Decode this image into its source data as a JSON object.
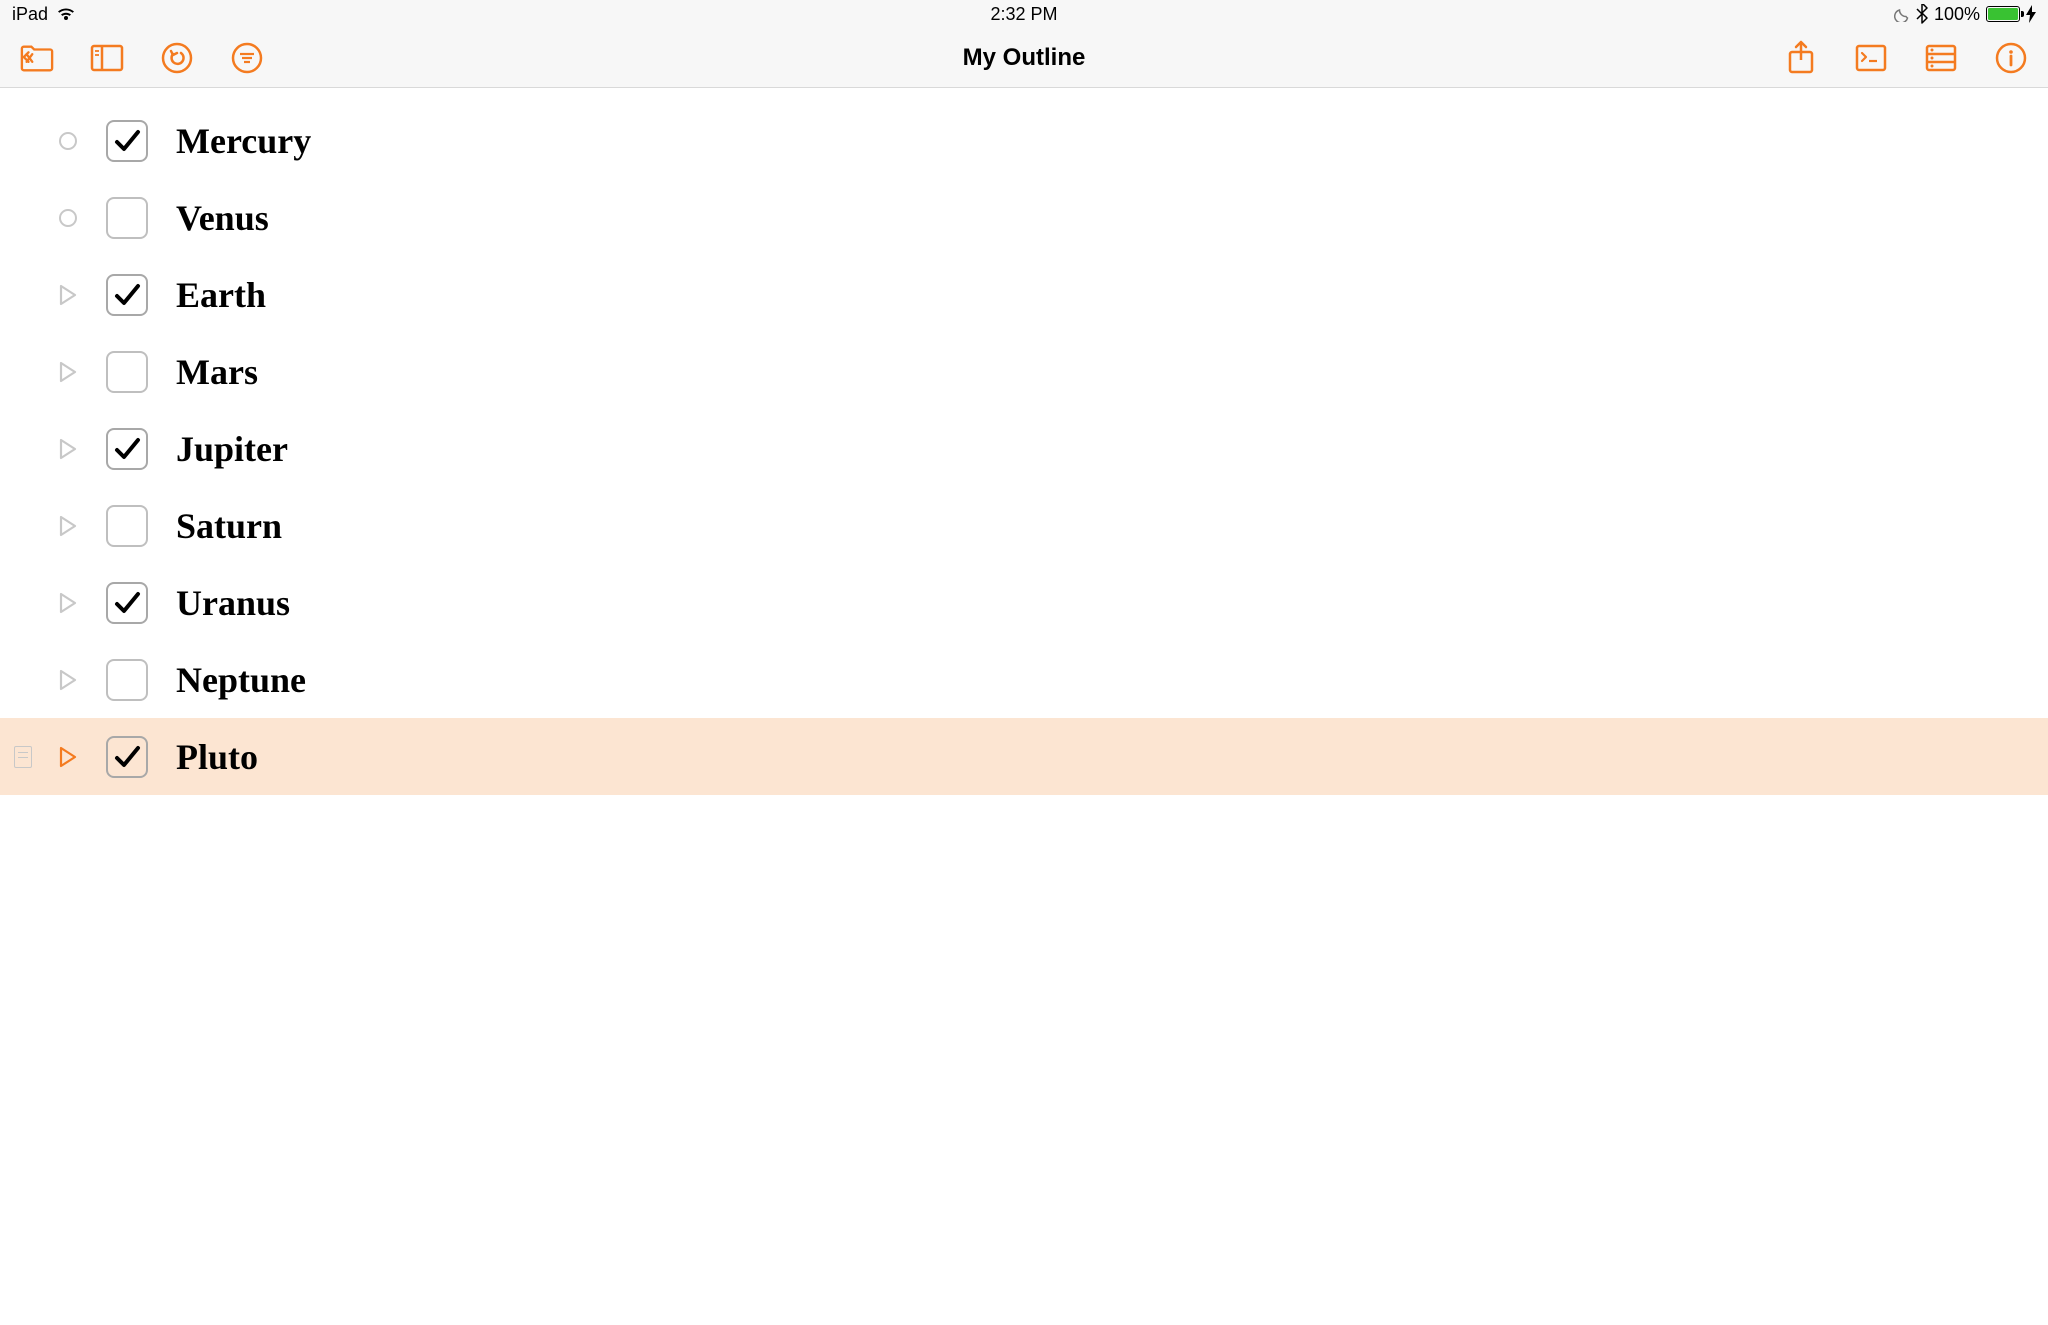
{
  "status_bar": {
    "device": "iPad",
    "time": "2:32 PM",
    "battery_pct": "100%"
  },
  "toolbar": {
    "title": "My Outline"
  },
  "colors": {
    "accent": "#f47b20",
    "selection_bg": "#fce5d2",
    "battery_fill": "#39c232"
  },
  "outline": {
    "items": [
      {
        "label": "Mercury",
        "checked": true,
        "handle": "circle",
        "selected": false,
        "has_note": false
      },
      {
        "label": "Venus",
        "checked": false,
        "handle": "circle",
        "selected": false,
        "has_note": false
      },
      {
        "label": "Earth",
        "checked": true,
        "handle": "triangle",
        "selected": false,
        "has_note": false
      },
      {
        "label": "Mars",
        "checked": false,
        "handle": "triangle",
        "selected": false,
        "has_note": false
      },
      {
        "label": "Jupiter",
        "checked": true,
        "handle": "triangle",
        "selected": false,
        "has_note": false
      },
      {
        "label": "Saturn",
        "checked": false,
        "handle": "triangle",
        "selected": false,
        "has_note": false
      },
      {
        "label": "Uranus",
        "checked": true,
        "handle": "triangle",
        "selected": false,
        "has_note": false
      },
      {
        "label": "Neptune",
        "checked": false,
        "handle": "triangle",
        "selected": false,
        "has_note": false
      },
      {
        "label": "Pluto",
        "checked": true,
        "handle": "triangle",
        "selected": true,
        "has_note": true
      }
    ]
  }
}
